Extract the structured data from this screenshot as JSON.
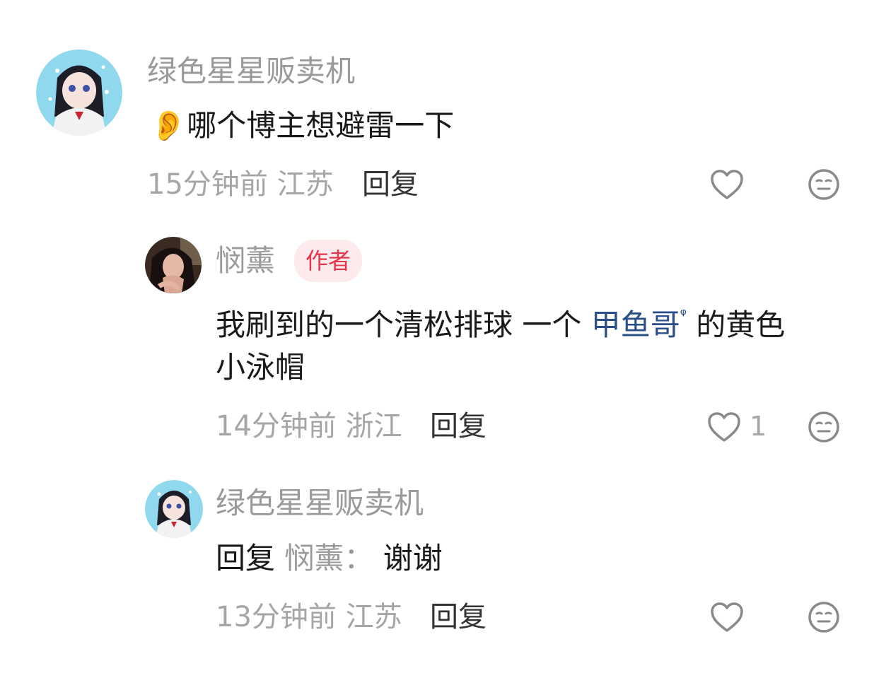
{
  "comments": [
    {
      "username": "绿色星星贩卖机",
      "emoji": "👂",
      "text": "哪个博主想避雷一下",
      "time": "15分钟前",
      "location": "江苏",
      "reply_label": "回复"
    },
    {
      "username": "悯薰",
      "badge": "作者",
      "text_part1": "我刷到的一个清松排球 一个 ",
      "topic": "甲鱼哥",
      "topic_mark": "ᵠ",
      "text_part2": " 的黄色",
      "text_line2": "小泳帽",
      "time": "14分钟前",
      "location": "浙江",
      "reply_label": "回复",
      "like_count": "1"
    },
    {
      "username": "绿色星星贩卖机",
      "reply_prefix": "回复",
      "mention": "悯薰",
      "separator": "：",
      "text": "谢谢",
      "time": "13分钟前",
      "location": "江苏",
      "reply_label": "回复"
    }
  ],
  "icons": {
    "like": "heart-icon",
    "dislike": "meh-face-icon"
  },
  "colors": {
    "badge_bg": "#fdeaec",
    "badge_text": "#e5354b",
    "topic_link": "#2a4f86"
  }
}
